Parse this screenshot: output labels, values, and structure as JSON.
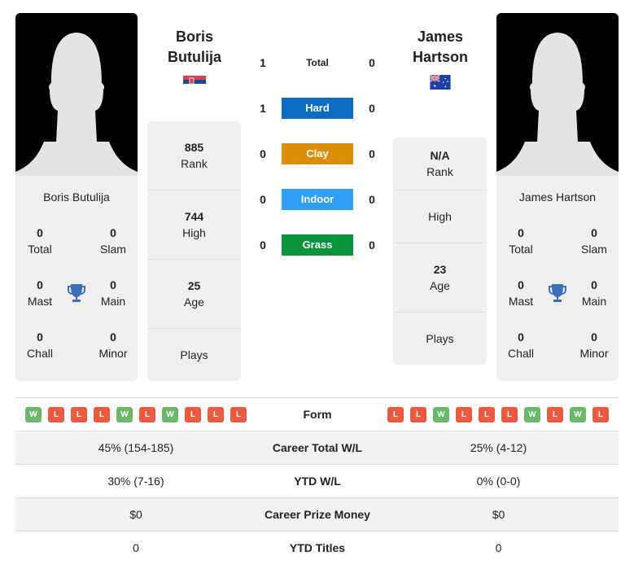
{
  "players": [
    {
      "name_line1": "Boris",
      "name_line2": "Butulija",
      "full_name": "Boris Butulija",
      "flag": "serbia-flag",
      "titles": {
        "total": "0",
        "slam": "0",
        "mast": "0",
        "main": "0",
        "chall": "0",
        "minor": "0"
      },
      "info": {
        "rank": "885",
        "high": "744",
        "age": "25",
        "plays": ""
      },
      "form": [
        "W",
        "L",
        "L",
        "L",
        "W",
        "L",
        "W",
        "L",
        "L",
        "L"
      ],
      "career_total_wl": "45% (154-185)",
      "ytd_wl": "30% (7-16)",
      "career_prize_money": "$0",
      "ytd_titles": "0"
    },
    {
      "name_line1": "James",
      "name_line2": "Hartson",
      "full_name": "James Hartson",
      "flag": "australia-flag",
      "titles": {
        "total": "0",
        "slam": "0",
        "mast": "0",
        "main": "0",
        "chall": "0",
        "minor": "0"
      },
      "info": {
        "rank": "N/A",
        "high": "",
        "age": "23",
        "plays": ""
      },
      "form": [
        "L",
        "L",
        "W",
        "L",
        "L",
        "L",
        "W",
        "L",
        "W",
        "L"
      ],
      "career_total_wl": "25% (4-12)",
      "ytd_wl": "0% (0-0)",
      "career_prize_money": "$0",
      "ytd_titles": "0"
    }
  ],
  "labels": {
    "total": "Total",
    "slam": "Slam",
    "mast": "Mast",
    "main": "Main",
    "chall": "Chall",
    "minor": "Minor",
    "rank": "Rank",
    "high": "High",
    "age": "Age",
    "plays": "Plays",
    "form": "Form",
    "career_total_wl": "Career Total W/L",
    "ytd_wl": "YTD W/L",
    "career_prize_money": "Career Prize Money",
    "ytd_titles": "YTD Titles"
  },
  "h2h": [
    {
      "label": "Total",
      "left": "1",
      "right": "0",
      "color": ""
    },
    {
      "label": "Hard",
      "left": "1",
      "right": "0",
      "color": "#0a6cc2"
    },
    {
      "label": "Clay",
      "left": "0",
      "right": "0",
      "color": "#de8d06"
    },
    {
      "label": "Indoor",
      "left": "0",
      "right": "0",
      "color": "#2d9ff5"
    },
    {
      "label": "Grass",
      "left": "0",
      "right": "0",
      "color": "#0a943c"
    }
  ],
  "colors": {
    "win": "#6ab96a",
    "loss": "#ec5b41",
    "trophy": "#3b6fb8"
  }
}
